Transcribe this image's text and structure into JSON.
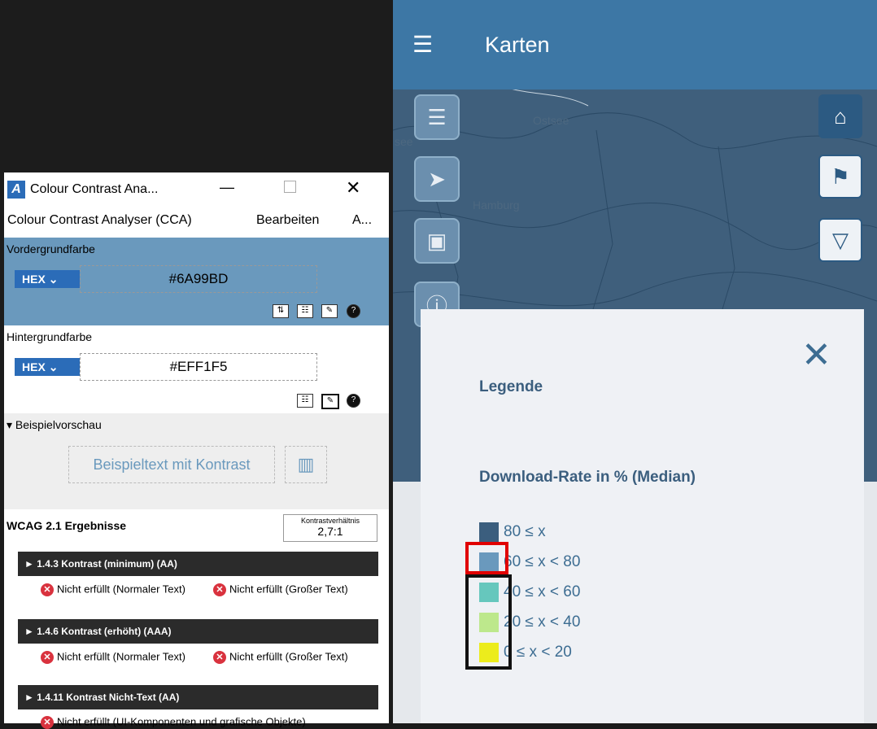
{
  "cca": {
    "window_title": "Colour Contrast Ana...",
    "window_controls": {
      "minimize": "—",
      "close": "✕"
    },
    "menu": [
      "Colour Contrast Analyser (CCA)",
      "Bearbeiten",
      "A..."
    ],
    "foreground": {
      "title": "Vordergrundfarbe",
      "format": "HEX",
      "value": "#6A99BD",
      "color": "#6A99BD"
    },
    "background": {
      "title": "Hintergrundfarbe",
      "format": "HEX",
      "value": "#EFF1F5",
      "color": "#EFF1F5"
    },
    "preview": {
      "title": "▾ Beispielvorschau",
      "sample_text": "Beispieltext mit Kontrast"
    },
    "results": {
      "title": "WCAG 2.1 Ergebnisse",
      "ratio_label": "Kontrastverhältnis",
      "ratio_value": "2,7:1",
      "criteria": [
        {
          "label": "► 1.4.3 Kontrast (minimum) (AA)",
          "fail_normal": "Nicht erfüllt (Normaler Text)",
          "fail_large": "Nicht erfüllt (Großer Text)"
        },
        {
          "label": "► 1.4.6 Kontrast (erhöht) (AAA)",
          "fail_normal": "Nicht erfüllt (Normaler Text)",
          "fail_large": "Nicht erfüllt (Großer Text)"
        },
        {
          "label": "► 1.4.11 Kontrast Nicht-Text (AA)"
        }
      ],
      "cut_off_text": "Nicht erfüllt (UI-Komponenten und grafische Objekte)"
    }
  },
  "map_app": {
    "title": "Karten",
    "map_labels": {
      "sea": "Ostsee",
      "city": "Hamburg",
      "see": "see"
    },
    "legend": {
      "heading": "Legende",
      "subheading": "Download-Rate in % (Median)",
      "classes": [
        {
          "label": "80 ≤ x",
          "color": "#3b5e7e"
        },
        {
          "label": "60 ≤ x < 80",
          "color": "#6a99bd"
        },
        {
          "label": "40 ≤ x < 60",
          "color": "#66c7bd"
        },
        {
          "label": "20 ≤ x < 40",
          "color": "#bde88c"
        },
        {
          "label": "0 ≤ x < 20",
          "color": "#ecec1c"
        }
      ]
    }
  },
  "highlight_colors": {
    "red": "#e00000",
    "black": "#111111"
  }
}
